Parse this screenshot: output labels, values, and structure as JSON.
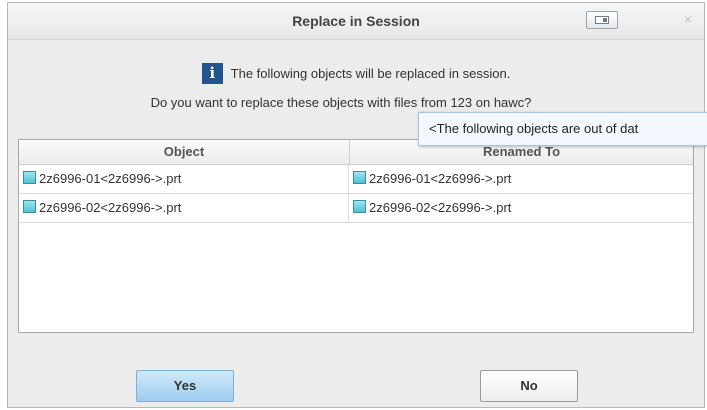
{
  "dialog": {
    "title": "Replace in Session",
    "message_line1": "The following objects will be replaced in session.",
    "message_line2": "Do you want to replace these objects with files from 123 on hawc?",
    "tooltip": "<The following objects are out of dat",
    "info_glyph": "i",
    "close_glyph": "×"
  },
  "table": {
    "columns": [
      "Object",
      "Renamed To"
    ],
    "rows": [
      {
        "object": "2z6996-01<2z6996->.prt",
        "renamed": "2z6996-01<2z6996->.prt"
      },
      {
        "object": "2z6996-02<2z6996->.prt",
        "renamed": "2z6996-02<2z6996->.prt"
      }
    ]
  },
  "buttons": {
    "yes": "Yes",
    "no": "No"
  },
  "icons": {
    "info": "info-icon",
    "part": "part-file-icon",
    "dock": "dock-window-icon",
    "close": "close-icon"
  },
  "colors": {
    "info_icon_bg": "#23548f",
    "yes_button": "#b6dbf6",
    "part_icon": "#6fd0e2"
  }
}
